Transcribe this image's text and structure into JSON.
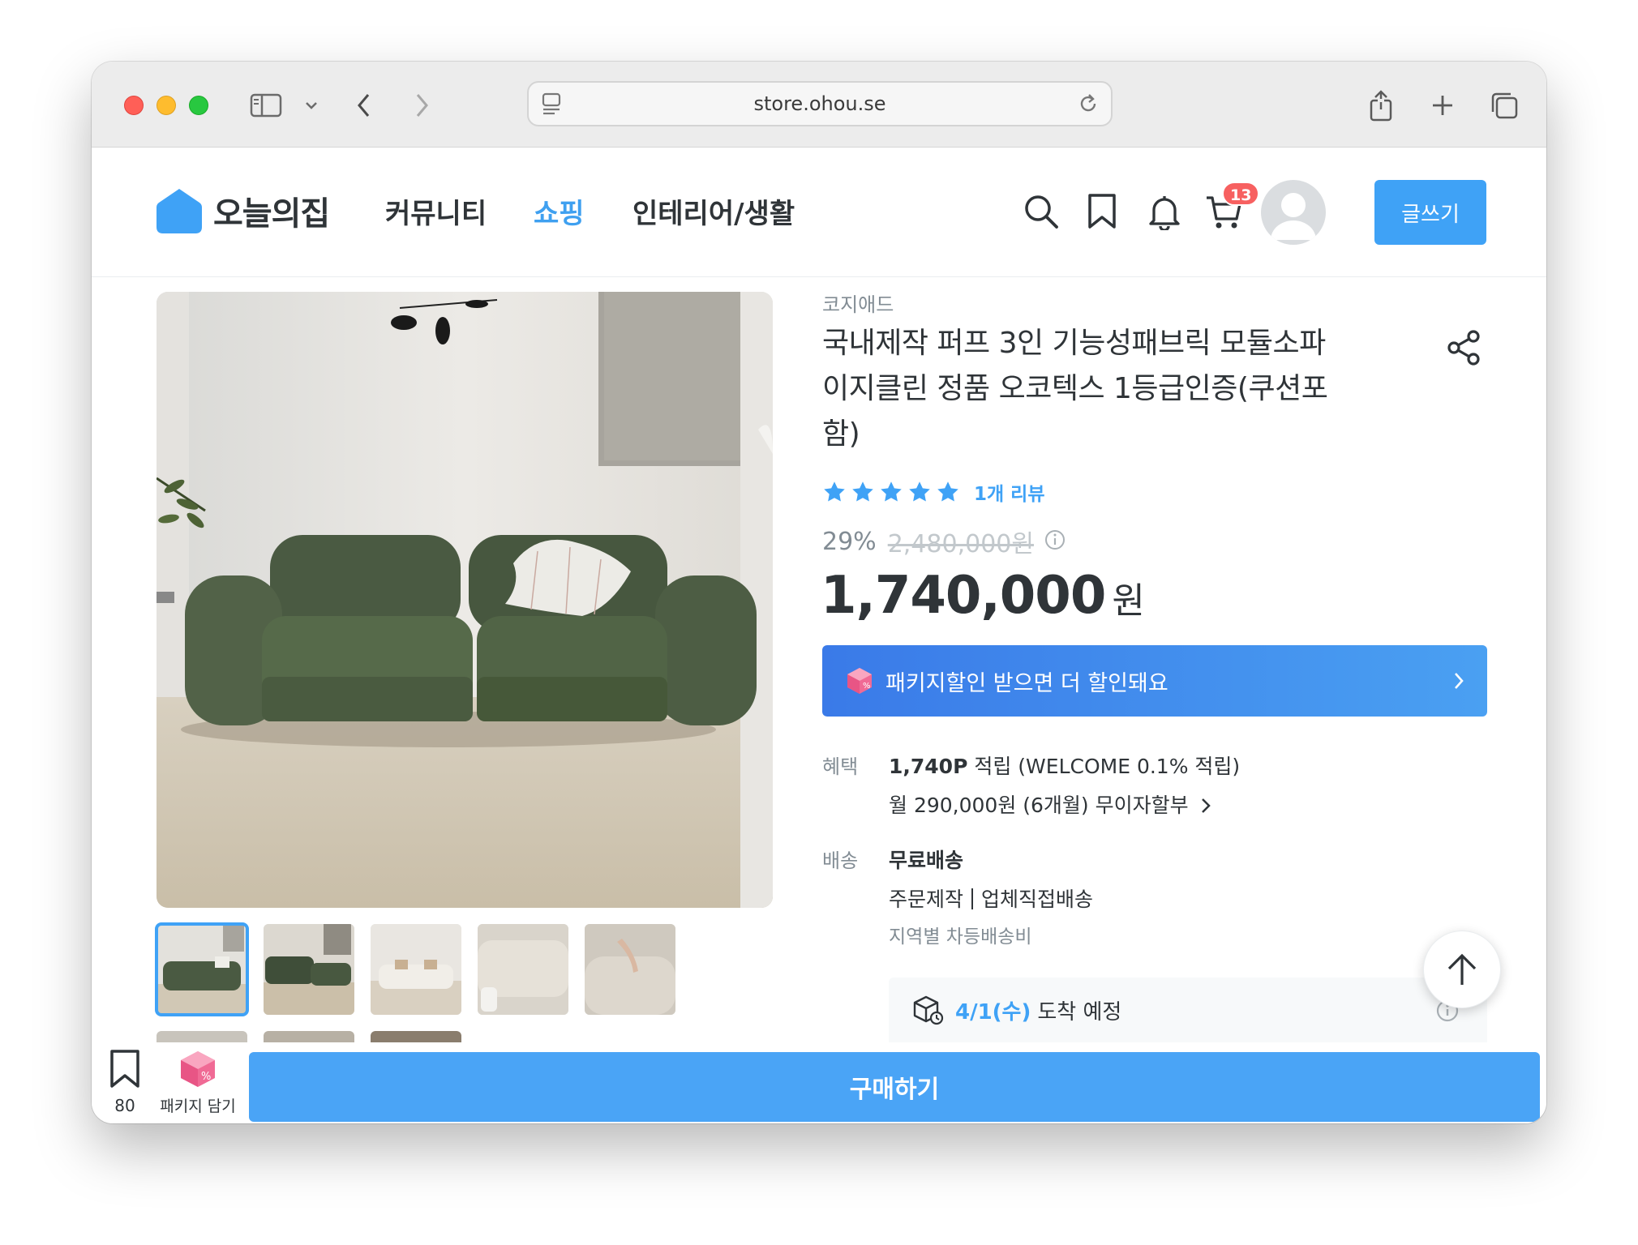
{
  "browser": {
    "url": "store.ohou.se"
  },
  "header": {
    "logo_text": "오늘의집",
    "nav": [
      "커뮤니티",
      "쇼핑",
      "인테리어/생활"
    ],
    "active_nav": "쇼핑",
    "cart_count": "13",
    "write_button": "글쓰기"
  },
  "product": {
    "brand": "코지애드",
    "title": "국내제작 퍼프 3인 기능성패브릭 모듈소파 이지클린 정품 오코텍스 1등급인증(쿠션포함)",
    "rating_stars": 5,
    "review_link": "1개 리뷰",
    "discount_percent": "29%",
    "original_price": "2,480,000원",
    "sale_price": "1,740,000",
    "sale_price_unit": "원",
    "package_banner": "패키지할인 받으면 더 할인돼요"
  },
  "benefits": {
    "label": "혜택",
    "points_bold": "1,740P",
    "points_text": "적립 (WELCOME 0.1% 적립)",
    "installment": "월 290,000원 (6개월) 무이자할부"
  },
  "shipping": {
    "label": "배송",
    "type": "무료배송",
    "method_a": "주문제작",
    "method_b": "업체직접배송",
    "note": "지역별 차등배송비",
    "arrival_date": "4/1(수)",
    "arrival_label": "도착 예정"
  },
  "bottom_bar": {
    "bookmark_count": "80",
    "package_label": "패키지 담기",
    "buy_button": "구매하기"
  },
  "colors": {
    "brand_blue": "#3fa2f6",
    "badge_red": "#f76060",
    "sofa_green": "#4a5a42"
  }
}
